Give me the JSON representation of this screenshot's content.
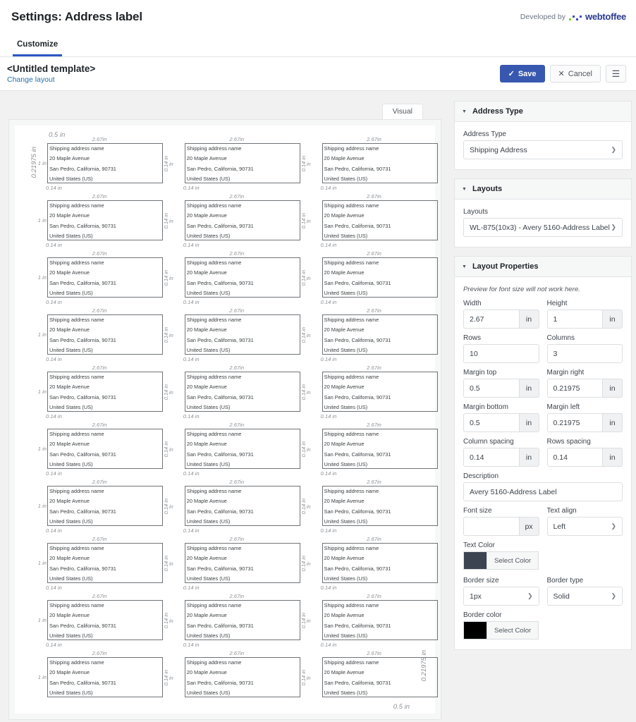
{
  "header": {
    "title": "Settings: Address label",
    "developed_by": "Developed by",
    "brand": "webtoffee",
    "logo_colors": [
      "#7ed321",
      "#3b4bb8",
      "#3b4bb8",
      "#3b4bb8"
    ]
  },
  "tabs": [
    {
      "label": "Customize",
      "active": true
    }
  ],
  "template_bar": {
    "name": "<Untitled template>",
    "change_layout": "Change layout",
    "save_label": "Save",
    "save_icon": "check-icon",
    "cancel_label": "Cancel",
    "cancel_icon": "close-icon",
    "menu_icon": "hamburger-icon",
    "accent": "#3858b0"
  },
  "preview": {
    "visual_tab": "Visual",
    "margin_top": "0.5 in",
    "margin_bottom": "0.5 in",
    "margin_left": "0.21975 in",
    "margin_right": "0.21975 in",
    "label_width": "2.67in",
    "label_height": "1 in",
    "column_spacing": "0.14 in",
    "row_spacing": "0.14 in",
    "rows": 10,
    "columns": 3,
    "label_lines": [
      "Shipping address name",
      "20 Maple Avenue",
      "San Pedro, California, 90731",
      "United States (US)"
    ]
  },
  "settings": {
    "address_type_panel": {
      "title": "Address Type",
      "field_label": "Address Type",
      "value": "Shipping Address"
    },
    "layouts_panel": {
      "title": "Layouts",
      "field_label": "Layouts",
      "value": "WL-875(10x3) - Avery 5160-Address Label"
    },
    "layout_properties_panel": {
      "title": "Layout Properties",
      "note": "Preview for font size will not work here.",
      "width": {
        "label": "Width",
        "value": "2.67",
        "unit": "in"
      },
      "height": {
        "label": "Height",
        "value": "1",
        "unit": "in"
      },
      "rows": {
        "label": "Rows",
        "value": "10"
      },
      "columns": {
        "label": "Columns",
        "value": "3"
      },
      "margin_top": {
        "label": "Margin top",
        "value": "0.5",
        "unit": "in"
      },
      "margin_right": {
        "label": "Margin right",
        "value": "0.21975",
        "unit": "in"
      },
      "margin_bottom": {
        "label": "Margin bottom",
        "value": "0.5",
        "unit": "in"
      },
      "margin_left": {
        "label": "Margin left",
        "value": "0.21975",
        "unit": "in"
      },
      "column_spacing": {
        "label": "Column spacing",
        "value": "0.14",
        "unit": "in"
      },
      "rows_spacing": {
        "label": "Rows spacing",
        "value": "0.14",
        "unit": "in"
      },
      "description": {
        "label": "Description",
        "value": "Avery 5160-Address Label"
      },
      "font_size": {
        "label": "Font size",
        "value": "",
        "unit": "px"
      },
      "text_align": {
        "label": "Text align",
        "value": "Left"
      },
      "text_color": {
        "label": "Text Color",
        "button": "Select Color",
        "color": "#3c4452"
      },
      "border_size": {
        "label": "Border size",
        "value": "1px"
      },
      "border_type": {
        "label": "Border type",
        "value": "Solid"
      },
      "border_color": {
        "label": "Border color",
        "button": "Select Color",
        "color": "#000000"
      }
    }
  }
}
